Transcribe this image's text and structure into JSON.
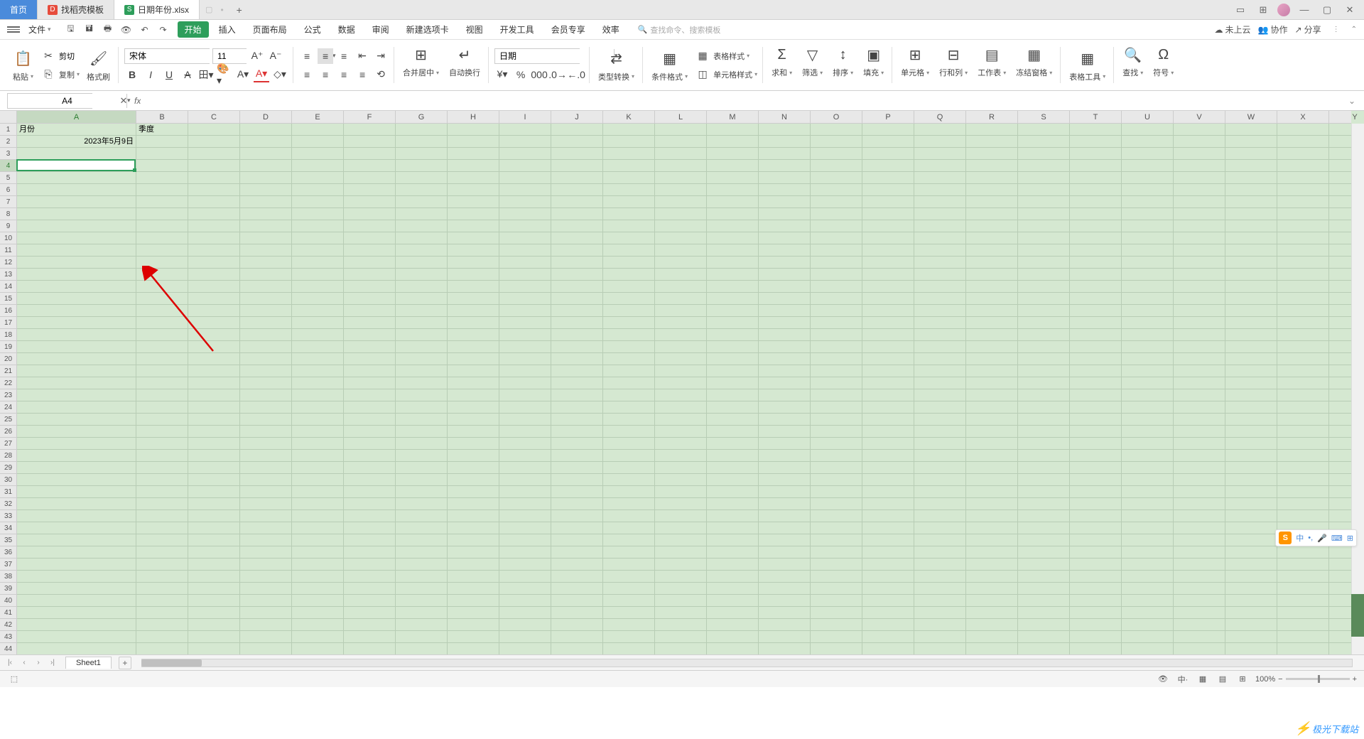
{
  "titlebar": {
    "home": "首页",
    "tab1": "找稻壳模板",
    "tab2": "日期年份.xlsx"
  },
  "menubar": {
    "file": "文件",
    "tabs": [
      "开始",
      "插入",
      "页面布局",
      "公式",
      "数据",
      "审阅",
      "新建选项卡",
      "视图",
      "开发工具",
      "会员专享",
      "效率"
    ],
    "search_ph": "查找命令、搜索模板",
    "cloud": "未上云",
    "collab": "协作",
    "share": "分享"
  },
  "ribbon": {
    "paste": "粘贴",
    "cut": "剪切",
    "copy": "复制",
    "painter": "格式刷",
    "font_name": "宋体",
    "font_size": "11",
    "merge": "合并居中",
    "wrap": "自动换行",
    "number_format": "日期",
    "type_convert": "类型转换",
    "cond_format": "条件格式",
    "table_style": "表格样式",
    "cell_style": "单元格样式",
    "sum": "求和",
    "filter": "筛选",
    "sort": "排序",
    "fill": "填充",
    "cells": "单元格",
    "rows_cols": "行和列",
    "worksheet": "工作表",
    "freeze": "冻结窗格",
    "table_tools": "表格工具",
    "find": "查找",
    "symbol": "符号"
  },
  "formula_bar": {
    "cell_ref": "A4",
    "fx": "fx"
  },
  "grid": {
    "columns": [
      "A",
      "B",
      "C",
      "D",
      "E",
      "F",
      "G",
      "H",
      "I",
      "J",
      "K",
      "L",
      "M",
      "N",
      "O",
      "P",
      "Q",
      "R",
      "S",
      "T",
      "U",
      "V",
      "W",
      "X",
      "Y"
    ],
    "col_a_width": 168,
    "default_col_width": 73,
    "rows": 44,
    "selected_col": "A",
    "selected_row": 4,
    "active": {
      "col": 0,
      "row": 3
    },
    "data": {
      "A1": "月份",
      "B1": "季度",
      "A2": "2023年5月9日"
    }
  },
  "ime": {
    "logo": "S",
    "lang": "中"
  },
  "sheetbar": {
    "sheet": "Sheet1"
  },
  "statusbar": {
    "zoom": "100%"
  },
  "watermark": "极光下载站"
}
